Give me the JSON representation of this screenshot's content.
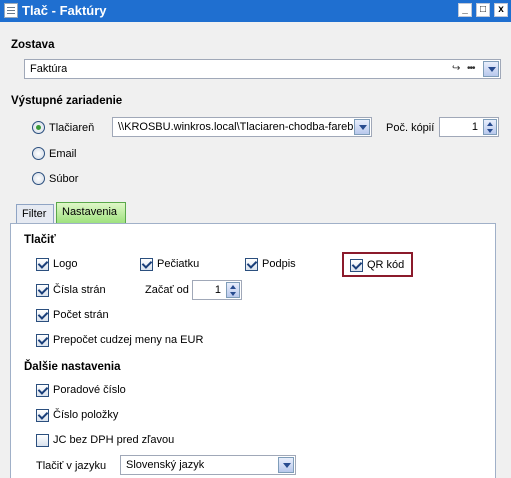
{
  "window": {
    "title": "Tlač - Faktúry",
    "min": "_",
    "max": "□",
    "close": "x"
  },
  "report": {
    "section": "Zostava",
    "value": "Faktúra",
    "link_icon": "↪",
    "more_icon": "•••"
  },
  "output": {
    "section": "Výstupné zariadenie",
    "options": [
      {
        "label": "Tlačiareň",
        "checked": true
      },
      {
        "label": "Email",
        "checked": false
      },
      {
        "label": "Súbor",
        "checked": false
      }
    ],
    "printer": "\\\\KROSBU.winkros.local\\Tlaciaren-chodba-farebn",
    "copies_label": "Poč. kópií",
    "copies_value": "1"
  },
  "tabs": [
    {
      "label": "Filter",
      "active": false
    },
    {
      "label": "Nastavenia",
      "active": true
    }
  ],
  "print_section": {
    "title": "Tlačiť",
    "logo": "Logo",
    "stamp": "Pečiatku",
    "signature": "Podpis",
    "qr": "QR kód",
    "page_numbers": "Čísla strán",
    "start_from_label": "Začať od",
    "start_from_value": "1",
    "page_count": "Počet strán",
    "currency_conv": "Prepočet cudzej meny na EUR"
  },
  "more_section": {
    "title": "Ďalšie nastavenia",
    "order_number": "Poradové číslo",
    "item_number": "Číslo položky",
    "unit_price": "JC bez DPH pred zľavou",
    "language_label": "Tlačiť v jazyku",
    "language_value": "Slovenský jazyk"
  },
  "colors": {
    "titlebar": "#1f6fd0",
    "highlight": "#8b1a2b",
    "active_tab": "#9be07a"
  }
}
